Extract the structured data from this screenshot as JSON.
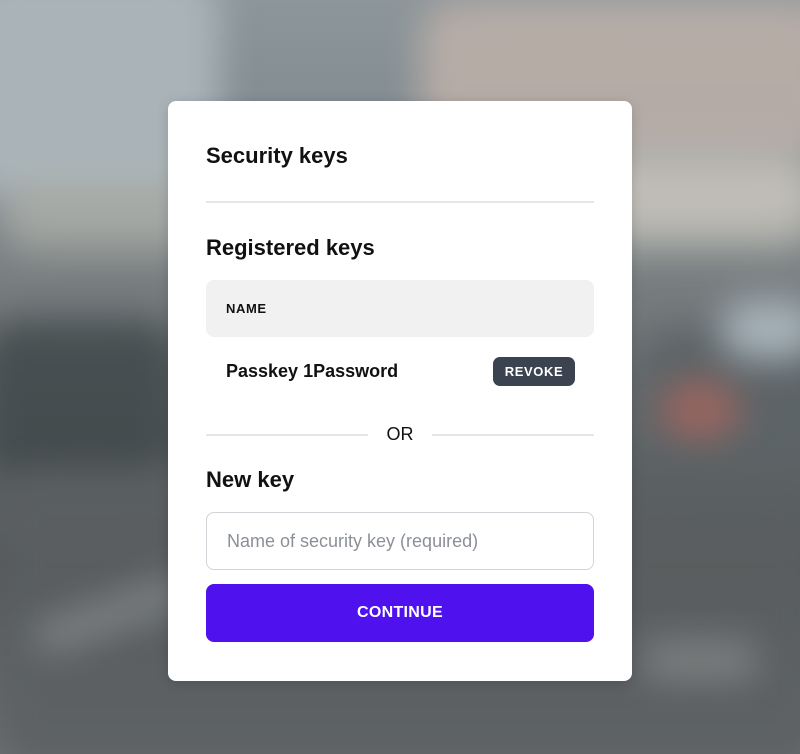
{
  "dialog": {
    "title": "Security keys"
  },
  "registered": {
    "heading": "Registered keys",
    "column_header": "NAME",
    "keys": [
      {
        "name": "Passkey 1Password",
        "action_label": "REVOKE"
      }
    ]
  },
  "separator": {
    "label": "OR"
  },
  "new_key": {
    "heading": "New key",
    "input_placeholder": "Name of security key (required)",
    "input_value": "",
    "submit_label": "CONTINUE"
  },
  "colors": {
    "primary": "#4f12ee",
    "revoke_bg": "#3b4350",
    "header_bg": "#f1f1f2"
  }
}
